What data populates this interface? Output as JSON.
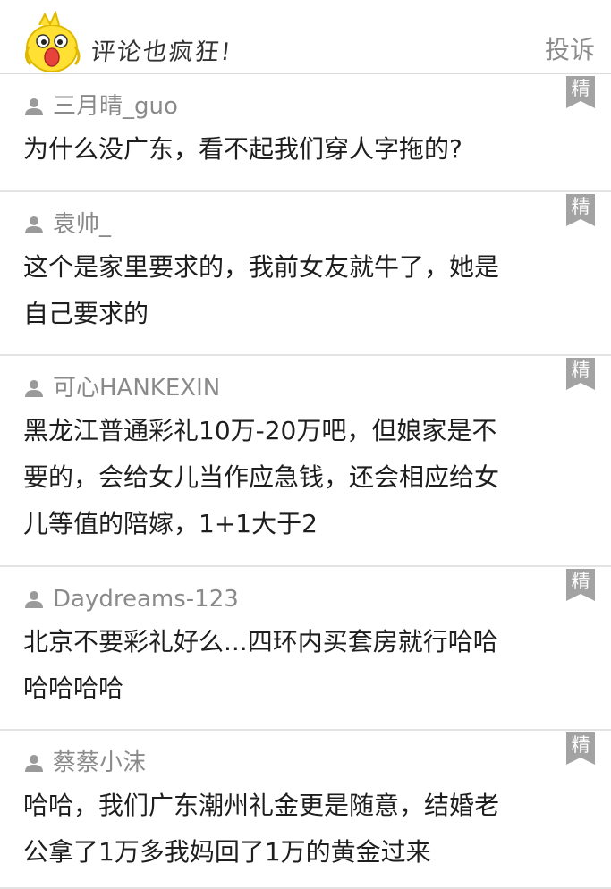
{
  "header": {
    "slogan": "评论也疯狂!",
    "report_label": "投诉"
  },
  "badge_label": "精",
  "comments": [
    {
      "user": "三月晴_guo",
      "lines": [
        "为什么没广东，看不起我们穿人字拖的?"
      ]
    },
    {
      "user": "袁帅_",
      "lines": [
        "这个是家里要求的，我前女友就牛了，她是",
        "自己要求的"
      ]
    },
    {
      "user": "可心HANKEXIN",
      "lines": [
        "黑龙江普通彩礼10万-20万吧，但娘家是不",
        "要的，会给女儿当作应急钱，还会相应给女",
        "儿等值的陪嫁，1+1大于2"
      ]
    },
    {
      "user": "Daydreams-123",
      "lines": [
        "北京不要彩礼好么...四环内买套房就行哈哈",
        "哈哈哈哈"
      ]
    },
    {
      "user": "蔡蔡小沫",
      "lines": [
        "哈哈，我们广东潮州礼金更是随意，结婚老",
        "公拿了1万多我妈回了1万的黄金过来"
      ]
    }
  ]
}
